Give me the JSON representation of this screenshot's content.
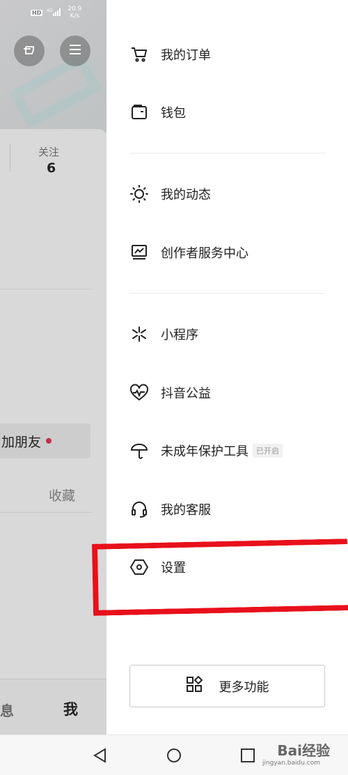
{
  "status_bar": {
    "hd": "HD",
    "network": "4G",
    "speed_value": "20.9",
    "speed_unit": "K/s"
  },
  "profile": {
    "follow_label": "关注",
    "follow_count": "6",
    "add_friend": "加朋友",
    "collect_tab": "收藏",
    "bottom_tabs": {
      "messages": "息",
      "me": "我"
    }
  },
  "drawer": {
    "items": [
      {
        "label": "我的订单",
        "icon": "cart-icon"
      },
      {
        "label": "钱包",
        "icon": "wallet-icon"
      },
      {
        "label": "我的动态",
        "icon": "sun-icon"
      },
      {
        "label": "创作者服务中心",
        "icon": "chart-monitor-icon"
      },
      {
        "label": "小程序",
        "icon": "asterisk-icon"
      },
      {
        "label": "抖音公益",
        "icon": "heart-pulse-icon"
      },
      {
        "label": "未成年保护工具",
        "icon": "umbrella-icon",
        "badge": "已开启"
      },
      {
        "label": "我的客服",
        "icon": "headset-icon"
      },
      {
        "label": "设置",
        "icon": "hex-nut-icon"
      }
    ],
    "more_button": {
      "label": "更多功能",
      "icon": "grid-icon"
    }
  },
  "watermark": {
    "brand": "Bai经验",
    "url": "jingyan.baidu.com"
  },
  "colors": {
    "highlight": "#e8101b",
    "background_dim": "#d8d8d8"
  }
}
